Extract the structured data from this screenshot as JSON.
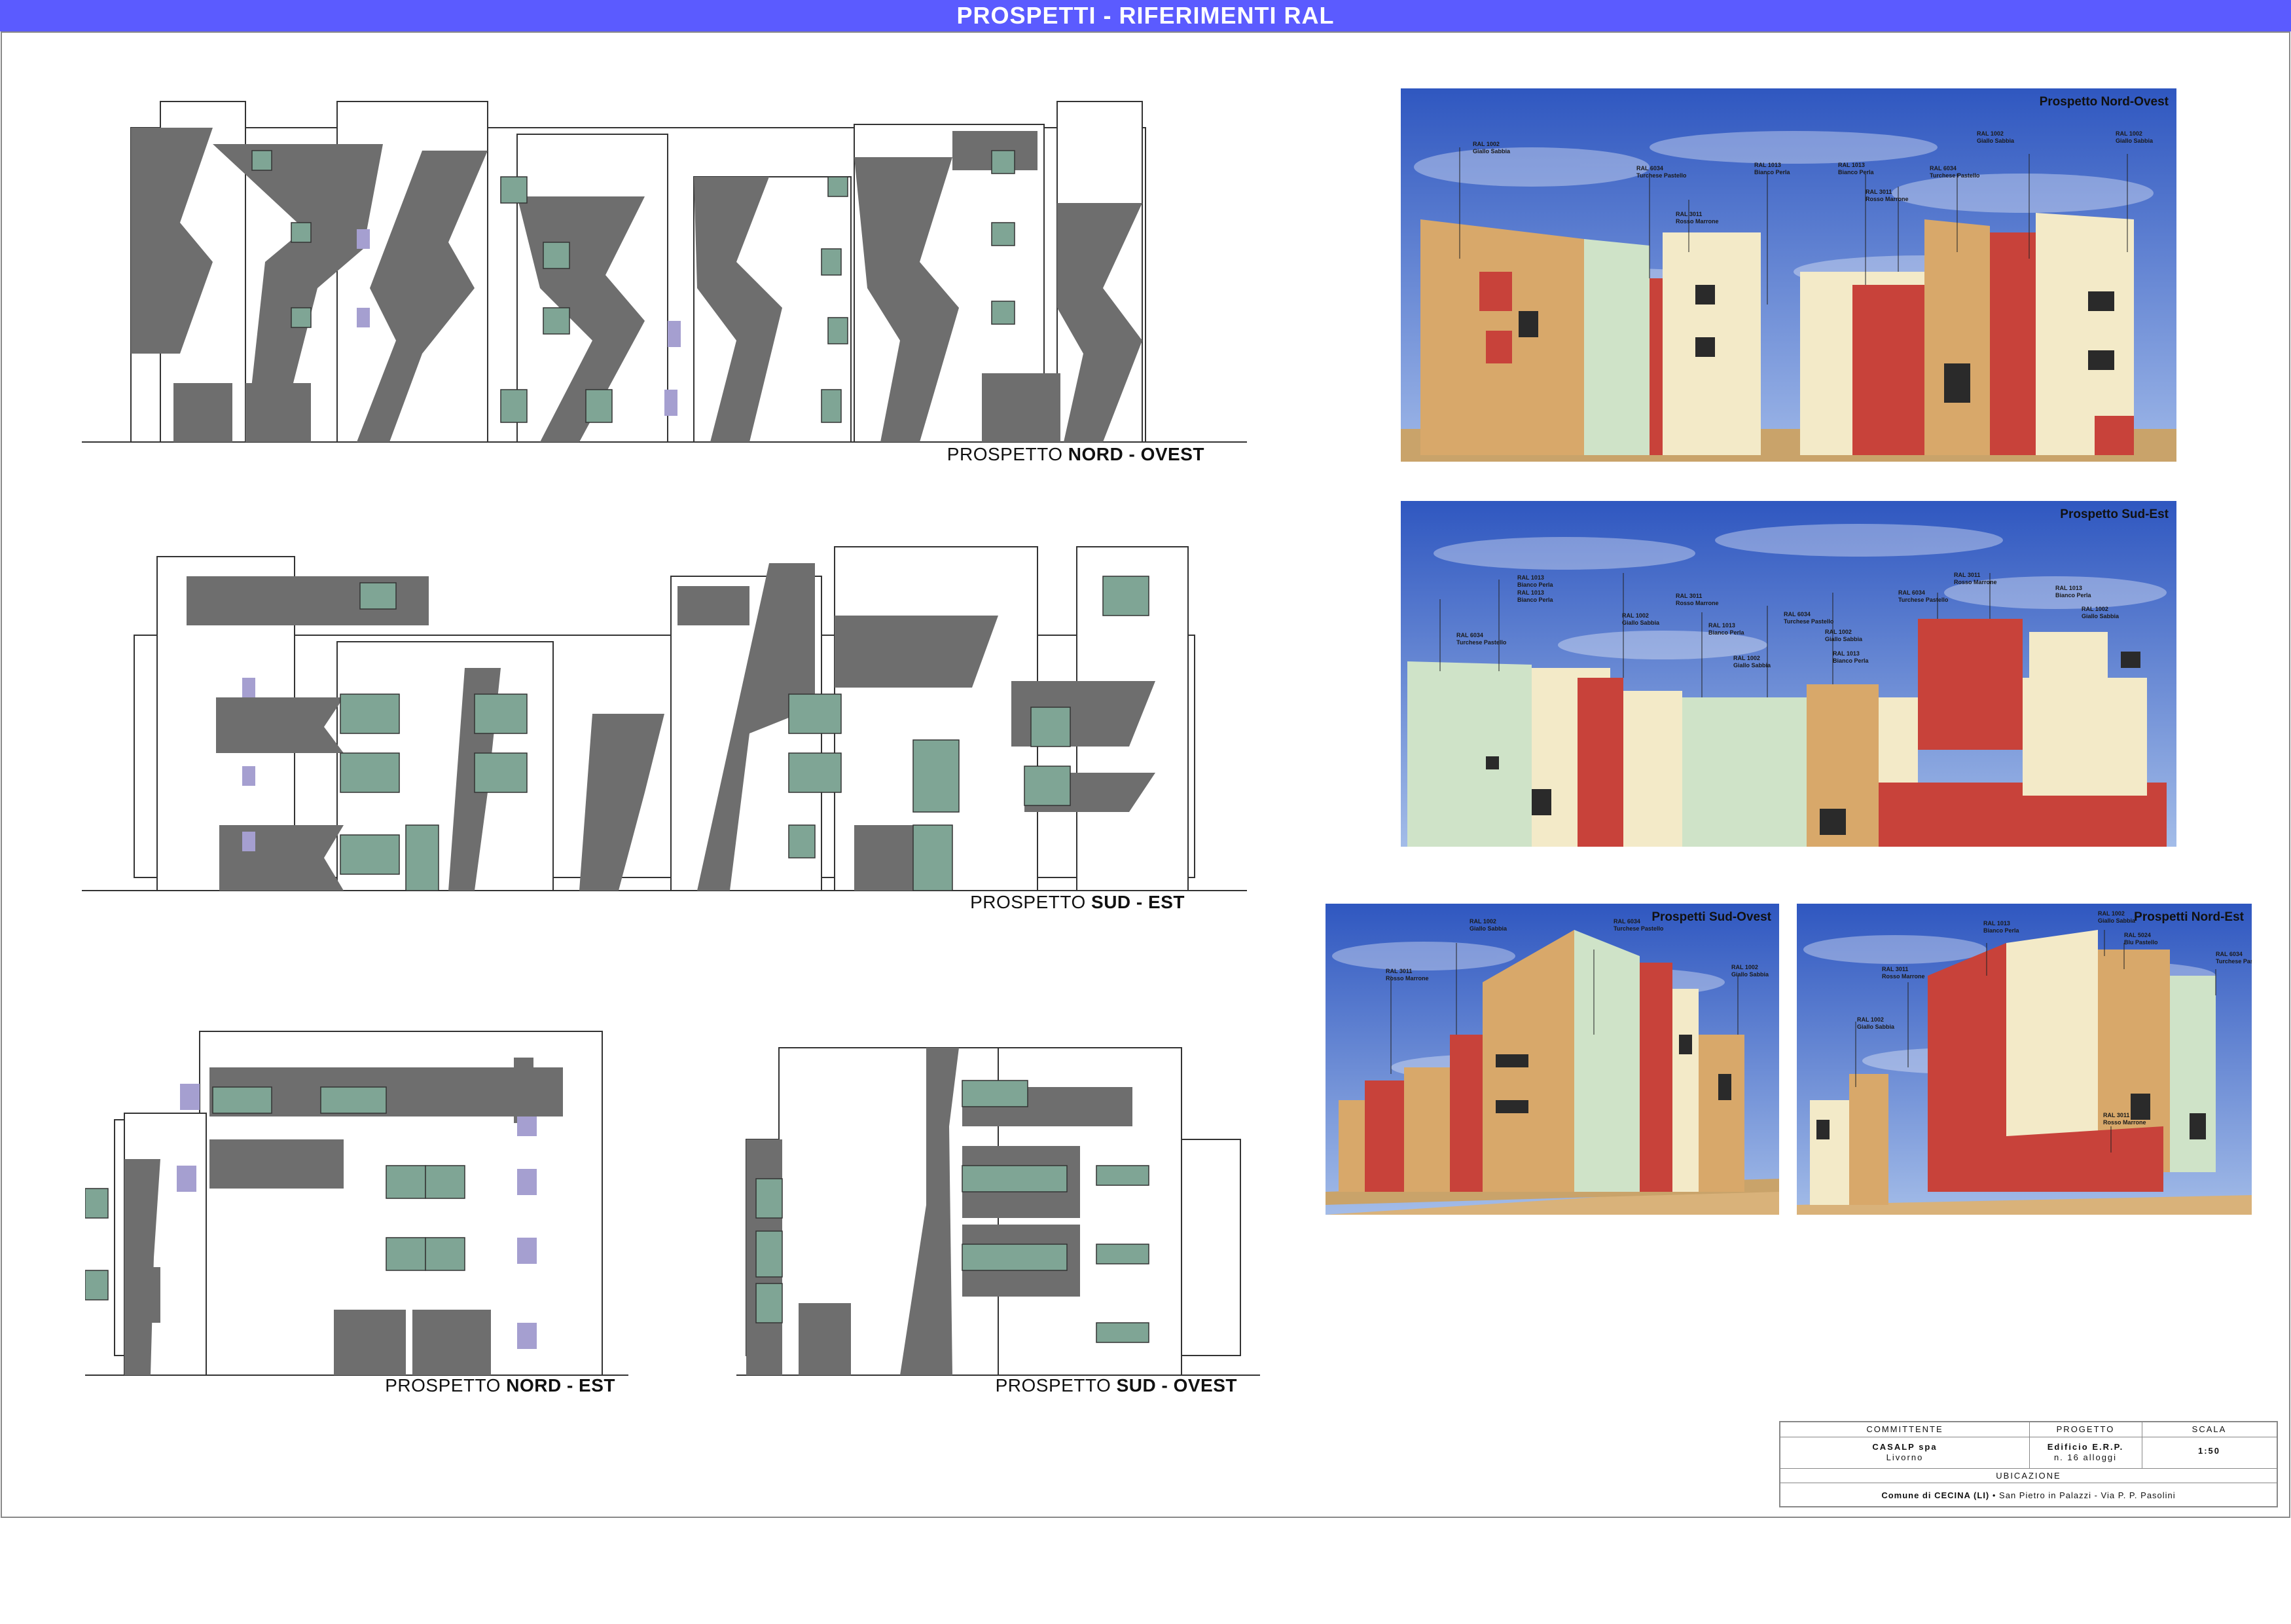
{
  "header": {
    "title": "PROSPETTI - RIFERIMENTI RAL"
  },
  "elevations": [
    {
      "prefix": "PROSPETTO ",
      "bold": "NORD - OVEST"
    },
    {
      "prefix": "PROSPETTO ",
      "bold": "SUD - EST"
    },
    {
      "prefix": "PROSPETTO ",
      "bold": "NORD - EST"
    },
    {
      "prefix": "PROSPETTO ",
      "bold": "SUD - OVEST"
    }
  ],
  "renders": [
    {
      "title": "Prospetto Nord-Ovest",
      "labels": [
        {
          "code": "RAL 1002",
          "name": "Giallo Sabbia"
        },
        {
          "code": "RAL 6034",
          "name": "Turchese Pastello"
        },
        {
          "code": "RAL 3011",
          "name": "Rosso Marrone"
        },
        {
          "code": "RAL 1013",
          "name": "Bianco Perla"
        },
        {
          "code": "RAL 1013",
          "name": "Bianco Perla"
        },
        {
          "code": "RAL 3011",
          "name": "Rosso Marrone"
        },
        {
          "code": "RAL 6034",
          "name": "Turchese Pastello"
        },
        {
          "code": "RAL 1002",
          "name": "Giallo Sabbia"
        },
        {
          "code": "RAL 1002",
          "name": "Giallo Sabbia"
        }
      ]
    },
    {
      "title": "Prospetto Sud-Est",
      "labels": [
        {
          "code": "RAL 6034",
          "name": "Turchese Pastello"
        },
        {
          "code": "RAL 1013",
          "name": "Bianco Perla"
        },
        {
          "code": "RAL 1013",
          "name": "Bianco Perla"
        },
        {
          "code": "RAL 1002",
          "name": "Giallo Sabbia"
        },
        {
          "code": "RAL 3011",
          "name": "Rosso Marrone"
        },
        {
          "code": "RAL 1013",
          "name": "Bianco Perla"
        },
        {
          "code": "RAL 1002",
          "name": "Giallo Sabbia"
        },
        {
          "code": "RAL 6034",
          "name": "Turchese Pastello"
        },
        {
          "code": "RAL 1002",
          "name": "Giallo Sabbia"
        },
        {
          "code": "RAL 1013",
          "name": "Bianco Perla"
        },
        {
          "code": "RAL 6034",
          "name": "Turchese Pastello"
        },
        {
          "code": "RAL 3011",
          "name": "Rosso Marrone"
        },
        {
          "code": "RAL 1013",
          "name": "Bianco Perla"
        },
        {
          "code": "RAL 1002",
          "name": "Giallo Sabbia"
        }
      ]
    },
    {
      "title": "Prospetti Sud-Ovest",
      "labels": [
        {
          "code": "RAL 3011",
          "name": "Rosso Marrone"
        },
        {
          "code": "RAL 1002",
          "name": "Giallo Sabbia"
        },
        {
          "code": "RAL 6034",
          "name": "Turchese Pastello"
        },
        {
          "code": "RAL 1002",
          "name": "Giallo Sabbia"
        }
      ]
    },
    {
      "title": "Prospetti Nord-Est",
      "labels": [
        {
          "code": "RAL 1002",
          "name": "Giallo Sabbia"
        },
        {
          "code": "RAL 3011",
          "name": "Rosso Marrone"
        },
        {
          "code": "RAL 1013",
          "name": "Bianco Perla"
        },
        {
          "code": "RAL 1002",
          "name": "Giallo Sabbia"
        },
        {
          "code": "RAL 5024",
          "name": "Blu Pastello"
        },
        {
          "code": "RAL 6034",
          "name": "Turchese Pastello"
        },
        {
          "code": "RAL 3011",
          "name": "Rosso Marrone"
        }
      ]
    }
  ],
  "title_block": {
    "committente_label": "COMMITTENTE",
    "committente_name": "CASALP spa",
    "committente_city": "Livorno",
    "progetto_label": "PROGETTO",
    "progetto_name": "Edificio E.R.P.",
    "progetto_detail": "n. 16 alloggi",
    "scala_label": "SCALA",
    "scala_value": "1:50",
    "ubicazione_label": "UBICAZIONE",
    "ubicazione_bold": "Comune di CECINA (LI)",
    "ubicazione_rest": " • San Pietro in Palazzi - Via P. P. Pasolini"
  },
  "colors": {
    "header_bg": "#5b5bff",
    "giallo_sabbia": "#d8a86a",
    "turchese_pastello": "#cfe3c8",
    "rosso_marrone": "#c8423a",
    "bianco_perla": "#f3eac8",
    "shadow_grey": "#6e6e6e",
    "glass_green": "#7fa595"
  }
}
